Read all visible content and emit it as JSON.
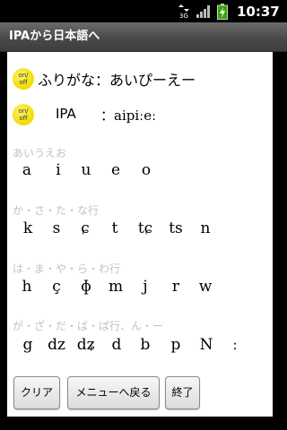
{
  "status_bar": {
    "network": "3G",
    "time": "10:37",
    "icons": [
      "network-3g-icon",
      "signal-icon",
      "battery-charging-icon"
    ]
  },
  "app": {
    "title": "IPAから日本語へ"
  },
  "furigana": {
    "toggle_top": "on/",
    "toggle_bottom": "off",
    "text": "ふりがな：あいぴーえー"
  },
  "ipa": {
    "toggle_top": "on/",
    "toggle_bottom": "off",
    "label": "IPA",
    "value": "：aipiːeː"
  },
  "groups": [
    {
      "title": "あいうえお",
      "symbols": [
        "a",
        "i",
        "u",
        "e",
        "o"
      ]
    },
    {
      "title": "か・さ・た・な行",
      "symbols": [
        "k",
        "s",
        "ɕ",
        "t",
        "tɕ",
        "ts",
        "n"
      ]
    },
    {
      "title": "は・ま・や・ら・わ行",
      "symbols": [
        "h",
        "ç",
        "ɸ",
        "m",
        "j",
        "r",
        "w"
      ]
    },
    {
      "title": "が・ざ・だ・ば・ぱ行、ん・ー",
      "symbols": [
        "g",
        "dz",
        "dʑ",
        "d",
        "b",
        "p",
        "N",
        "ː"
      ]
    }
  ],
  "buttons": {
    "clear": "クリア",
    "menu": "メニューへ戻る",
    "exit": "終了"
  },
  "colors": {
    "accent_yellow": "#f2dc00",
    "title_bar": "#555555",
    "group_title": "#c2c2c2"
  }
}
